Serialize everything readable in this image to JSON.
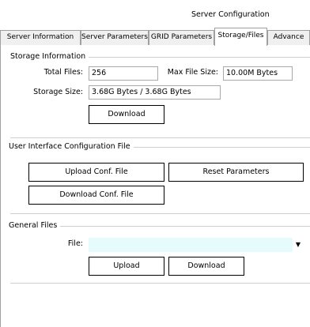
{
  "window": {
    "title": "Server Configuration"
  },
  "tabs": [
    {
      "label": "Server Information"
    },
    {
      "label": "Server Parameters"
    },
    {
      "label": "GRID Parameters"
    },
    {
      "label": "Storage/Files"
    },
    {
      "label": "Advance"
    }
  ],
  "storage": {
    "legend": "Storage Information",
    "total_files_label": "Total Files:",
    "total_files_value": "256",
    "max_file_size_label": "Max File Size:",
    "max_file_size_value": "10.00M Bytes",
    "storage_size_label": "Storage Size:",
    "storage_size_value": "3.68G Bytes / 3.68G Bytes",
    "download_label": "Download"
  },
  "ui_config": {
    "legend": "User Interface Configuration File",
    "upload_label": "Upload Conf. File",
    "reset_label": "Reset Parameters",
    "download_label": "Download Conf. File"
  },
  "general": {
    "legend": "General Files",
    "file_label": "File:",
    "file_value": "",
    "upload_label": "Upload",
    "download_label": "Download"
  },
  "colors": {
    "combo_background": "#e6fbfb",
    "border": "#a0a0a0"
  }
}
